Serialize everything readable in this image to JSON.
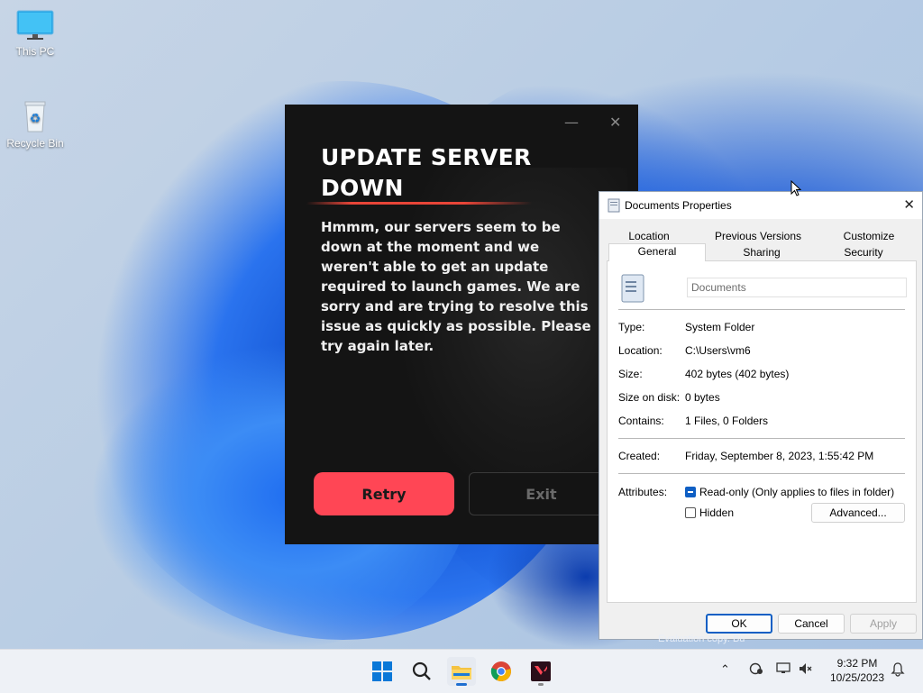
{
  "desktop": {
    "icons": [
      {
        "label": "This PC",
        "icon": "monitor-icon"
      },
      {
        "label": "Recycle Bin",
        "icon": "recycle-bin-icon"
      }
    ],
    "watermark": "Evaluation copy. Bu"
  },
  "riot_dialog": {
    "title": "UPDATE SERVER DOWN",
    "message": "Hmmm, our servers seem to be down at the moment and we weren't able to get an update required to launch games. We are sorry and are trying to resolve this issue as quickly as possible. Please try again later.",
    "retry_label": "Retry",
    "exit_label": "Exit",
    "accent_color": "#ff4655"
  },
  "properties_dialog": {
    "title": "Documents Properties",
    "tabs_row1": [
      "Location",
      "Previous Versions",
      "Customize"
    ],
    "tabs_row2": [
      "General",
      "Sharing",
      "Security"
    ],
    "active_tab": "General",
    "name_value": "Documents",
    "fields": [
      {
        "label": "Type:",
        "value": "System Folder"
      },
      {
        "label": "Location:",
        "value": "C:\\Users\\vm6"
      },
      {
        "label": "Size:",
        "value": "402 bytes (402 bytes)"
      },
      {
        "label": "Size on disk:",
        "value": "0 bytes"
      },
      {
        "label": "Contains:",
        "value": "1 Files, 0 Folders"
      }
    ],
    "created_label": "Created:",
    "created_value": "Friday, September 8, 2023, 1:55:42 PM",
    "attributes_label": "Attributes:",
    "readonly_label": "Read-only (Only applies to files in folder)",
    "readonly_state": "indeterminate",
    "hidden_label": "Hidden",
    "advanced_label": "Advanced...",
    "ok_label": "OK",
    "cancel_label": "Cancel",
    "apply_label": "Apply"
  },
  "taskbar": {
    "apps": [
      "start-icon",
      "search-icon",
      "file-explorer-icon",
      "chrome-icon",
      "valorant-icon"
    ],
    "time": "9:32 PM",
    "date": "10/25/2023"
  }
}
